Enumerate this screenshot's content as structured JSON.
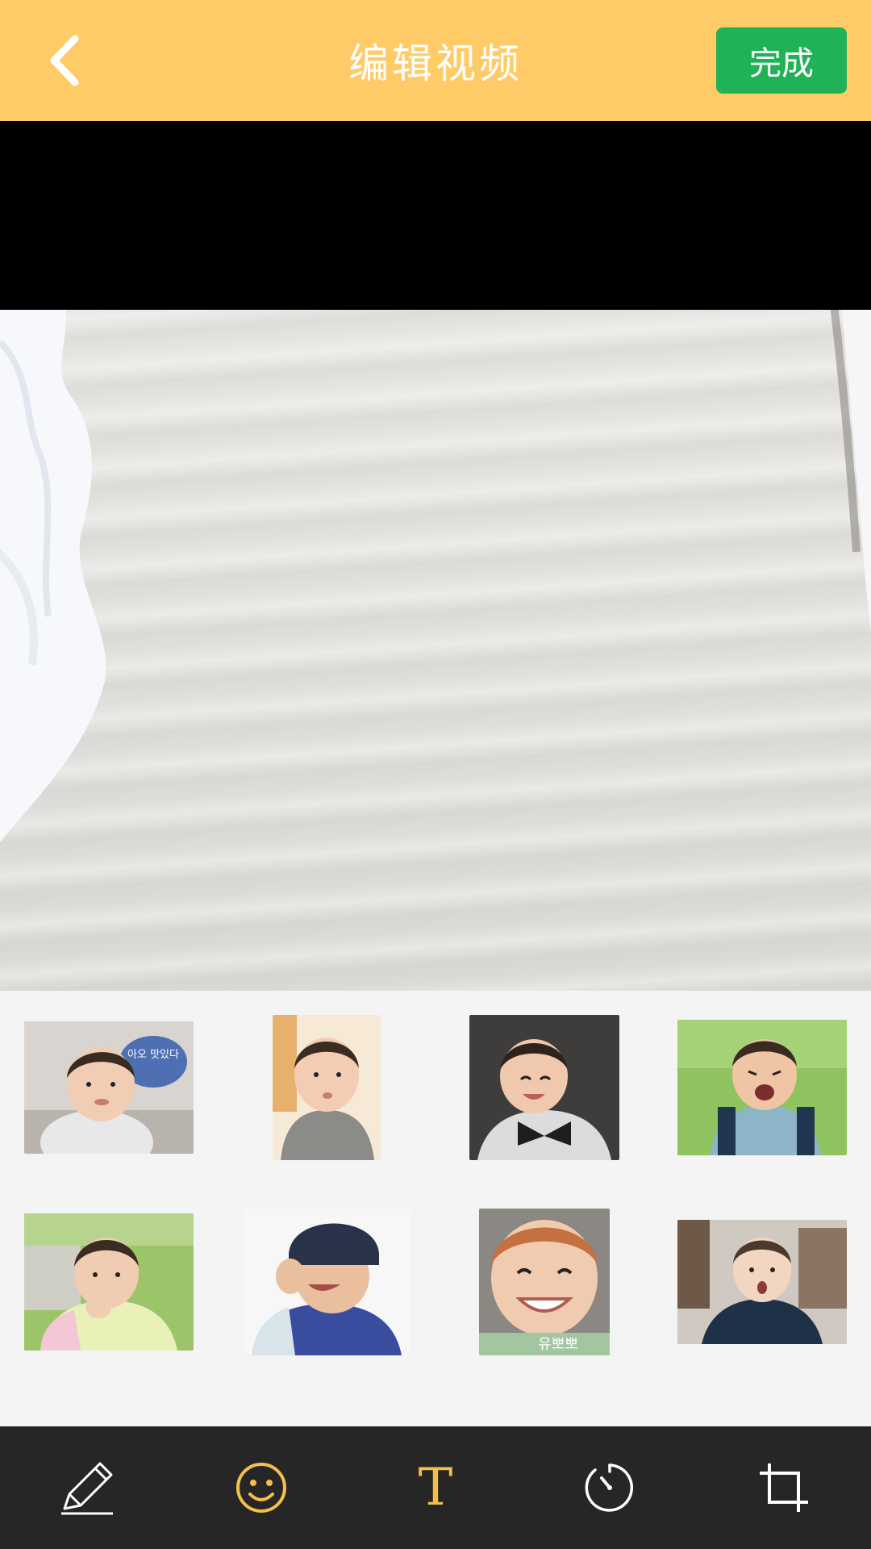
{
  "header": {
    "title": "编辑视频",
    "done_label": "完成",
    "background": "#ffcb66",
    "done_color": "#21b257"
  },
  "video": {
    "letterbox_color": "#000000"
  },
  "stickers": [
    {
      "name": "sticker-baby-speech-bubble",
      "text": "아오 맛있다"
    },
    {
      "name": "sticker-baby-eating"
    },
    {
      "name": "sticker-baby-bowtie-smile"
    },
    {
      "name": "sticker-baby-crying-backpack"
    },
    {
      "name": "sticker-baby-thinking-hanbok"
    },
    {
      "name": "sticker-baby-hat-laughing"
    },
    {
      "name": "sticker-baby-big-smile",
      "text": "유뽀뽀"
    },
    {
      "name": "sticker-baby-surprised"
    }
  ],
  "toolbar": {
    "tools": [
      {
        "name": "pencil-icon",
        "active": false
      },
      {
        "name": "smiley-icon",
        "active": true
      },
      {
        "name": "text-icon",
        "label": "T",
        "active": true
      },
      {
        "name": "timer-icon",
        "active": false
      },
      {
        "name": "crop-icon",
        "active": false
      }
    ],
    "active_color": "#f5c04a",
    "inactive_color": "#ffffff"
  }
}
